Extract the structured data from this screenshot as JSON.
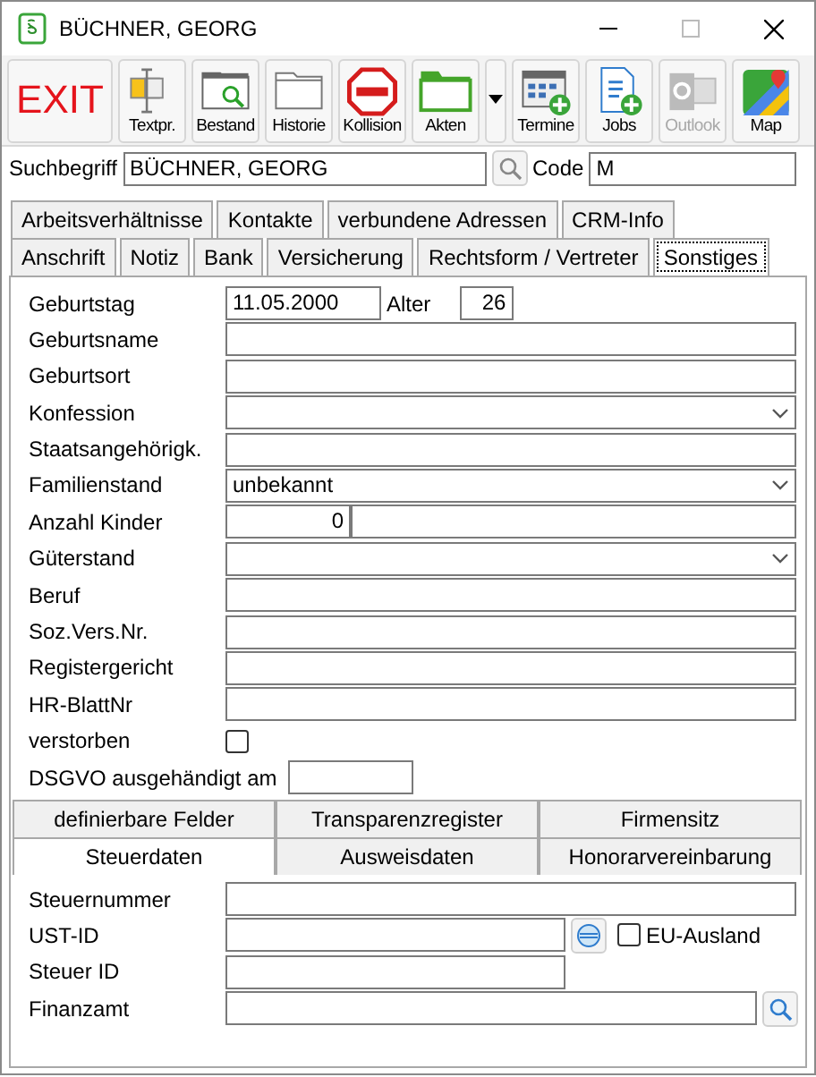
{
  "window": {
    "title": "BÜCHNER, GEORG"
  },
  "toolbar": [
    {
      "kind": "exit",
      "label": "EXIT",
      "disabled": false
    },
    {
      "kind": "tool",
      "label": "Textpr.",
      "disabled": false
    },
    {
      "kind": "tool",
      "label": "Bestand",
      "disabled": false
    },
    {
      "kind": "tool",
      "label": "Historie",
      "disabled": false
    },
    {
      "kind": "tool",
      "label": "Kollision",
      "disabled": false
    },
    {
      "kind": "tool",
      "label": "Akten",
      "disabled": false
    },
    {
      "kind": "dropdown",
      "disabled": false
    },
    {
      "kind": "tool",
      "label": "Termine",
      "disabled": false
    },
    {
      "kind": "tool",
      "label": "Jobs",
      "disabled": false
    },
    {
      "kind": "tool",
      "label": "Outlook",
      "disabled": true
    },
    {
      "kind": "tool",
      "label": "Map",
      "disabled": false
    }
  ],
  "search": {
    "label": "Suchbegriff",
    "value": "BÜCHNER, GEORG",
    "code_label": "Code",
    "code_value": "M"
  },
  "tabs_row_1": [
    {
      "label": "Arbeitsverhältnisse",
      "selected": false
    },
    {
      "label": "Kontakte",
      "selected": false
    },
    {
      "label": "verbundene Adressen",
      "selected": false
    },
    {
      "label": "CRM-Info",
      "selected": false
    }
  ],
  "tabs_row_2": [
    {
      "label": "Anschrift",
      "selected": false
    },
    {
      "label": "Notiz",
      "selected": false
    },
    {
      "label": "Bank",
      "selected": false
    },
    {
      "label": "Versicherung",
      "selected": false
    },
    {
      "label": "Rechtsform / Vertreter",
      "selected": false
    },
    {
      "label": "Sonstiges",
      "selected": true
    }
  ],
  "fields": [
    {
      "kind": "date_age",
      "label": "Geburtstag",
      "value": "11.05.2000",
      "age_label": "Alter",
      "age": "26"
    },
    {
      "kind": "text",
      "label": "Geburtsname"
    },
    {
      "kind": "text",
      "label": "Geburtsort"
    },
    {
      "kind": "combo",
      "label": "Konfession"
    },
    {
      "kind": "text",
      "label": "Staatsangehörigk."
    },
    {
      "kind": "combo",
      "label": "Familienstand",
      "value": "unbekannt"
    },
    {
      "kind": "number",
      "label": "Anzahl Kinder",
      "value": "0"
    },
    {
      "kind": "combo",
      "label": "Güterstand"
    },
    {
      "kind": "text",
      "label": "Beruf"
    },
    {
      "kind": "text",
      "label": "Soz.Vers.Nr."
    },
    {
      "kind": "text",
      "label": "Registergericht"
    },
    {
      "kind": "text",
      "label": "HR-BlattNr"
    },
    {
      "kind": "checkbox",
      "label": "verstorben",
      "checked": false
    },
    {
      "kind": "short",
      "label": "DSGVO ausgehändigt am"
    }
  ],
  "bottom_tabs_row_1": [
    {
      "label": "definierbare Felder",
      "selected": false
    },
    {
      "label": "Transparenzregister",
      "selected": false
    },
    {
      "label": "Firmensitz",
      "selected": false
    }
  ],
  "bottom_tabs_row_2": [
    {
      "label": "Steuerdaten",
      "selected": true
    },
    {
      "label": "Ausweisdaten",
      "selected": false
    },
    {
      "label": "Honorarvereinbarung",
      "selected": false
    }
  ],
  "tax": {
    "steuernummer_label": "Steuernummer",
    "ust_id_label": "UST-ID",
    "eu_label": "EU-Ausland",
    "eu_checked": false,
    "steuer_id_label": "Steuer ID",
    "finanzamt_label": "Finanzamt"
  }
}
